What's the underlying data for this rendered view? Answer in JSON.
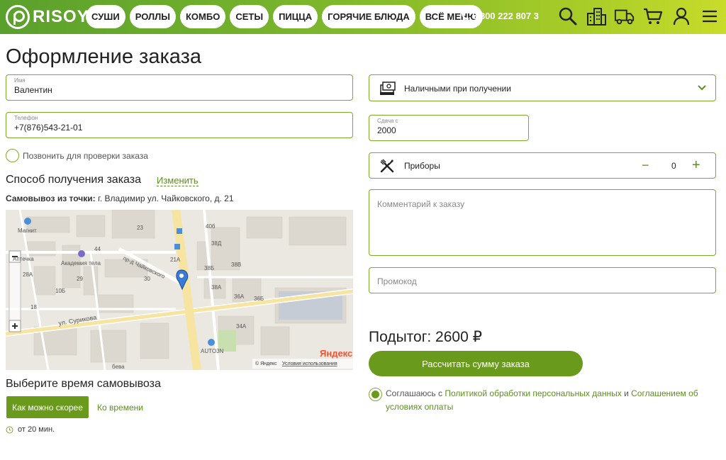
{
  "header": {
    "logo_text": "RISOY",
    "nav": [
      "СУШИ",
      "РОЛЛЫ",
      "КОМБО",
      "СЕТЫ",
      "ПИЦЦА",
      "ГОРЯЧИЕ БЛЮДА",
      "ВСЁ МЕНЮ"
    ],
    "phone": "8 800 222 807 3",
    "icons": [
      "search-icon",
      "buildings-icon",
      "delivery-truck-icon",
      "cart-icon",
      "user-icon",
      "menu-icon"
    ]
  },
  "page": {
    "title": "Оформление заказа"
  },
  "form": {
    "name_label": "Имя",
    "name_value": "Валентин",
    "phone_label": "Телефон",
    "phone_value": "+7(876)543-21-01",
    "call_check_label": "Позвонить для проверки заказа",
    "payment_method": "Наличными при получении",
    "change_label": "Сдача с",
    "change_value": "2000",
    "cutlery_label": "Приборы",
    "cutlery_minus": "−",
    "cutlery_count": "0",
    "cutlery_plus": "+",
    "comment_placeholder": "Комментарий к заказу",
    "promo_placeholder": "Промокод"
  },
  "delivery": {
    "title": "Способ получения заказа",
    "change_link": "Изменить",
    "pickup_prefix": "Самовывоз из точки:",
    "pickup_address": "г. Владимир ул. Чайковского, д. 21"
  },
  "map": {
    "labels": {
      "magnit": "Магнит",
      "academy": "Академия тела",
      "proezd": "пр-д Чайковского",
      "surikova": "ул. Сурикова",
      "autozn": "AUTO3N",
      "apteka": "Аптечка",
      "yandex": "Яндекс",
      "copyright": "© Яндекс",
      "terms": "Условия использования",
      "beba": "бева"
    },
    "houses": [
      "40б",
      "38Д",
      "38В",
      "38Б",
      "38А",
      "36А",
      "36Б",
      "34А",
      "21А",
      "23",
      "29",
      "44",
      "10Б",
      "28А",
      "30",
      "18"
    ],
    "zoom_minus": "−",
    "zoom_plus": "+"
  },
  "pickup_time": {
    "title": "Выберите время самовывоза",
    "asap": "Как можно скорее",
    "by_time": "Ко времени",
    "note": "от 20 мин."
  },
  "summary": {
    "subtotal": "Подытог: 2600 ₽",
    "calc_button": "Рассчитать сумму заказа",
    "agree_prefix": "Соглашаюсь с",
    "agree_link1": "Политикой обработки персональных данных",
    "agree_and": "и",
    "agree_link2": "Соглашением об условиях оплаты"
  },
  "colors": {
    "accent": "#6a9a1c",
    "border": "#7aab2a",
    "header_start": "#5aa02c",
    "header_end": "#c8dc2a"
  }
}
